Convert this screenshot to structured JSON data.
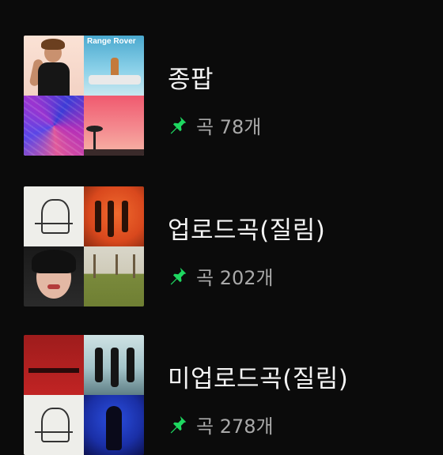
{
  "playlists": [
    {
      "title": "종팝",
      "count": "곡 78개",
      "covers": [
        "portrait",
        "range-rover",
        "abstract",
        "pink-sunset"
      ],
      "cover_text": "Range Rover"
    },
    {
      "title": "업로드곡(질림)",
      "count": "곡 202개",
      "covers": [
        "white-spider",
        "orange-band",
        "wet-portrait",
        "field"
      ]
    },
    {
      "title": "미업로드곡(질림)",
      "count": "곡 278개",
      "covers": [
        "red-poster",
        "teal-band",
        "white-spider",
        "blue-figure"
      ]
    }
  ],
  "colors": {
    "background": "#0b0b0b",
    "title": "#f4f4f4",
    "meta": "#a9a9a9",
    "pin": "#1ed760"
  },
  "icons": {
    "pinned": "pin-icon"
  }
}
